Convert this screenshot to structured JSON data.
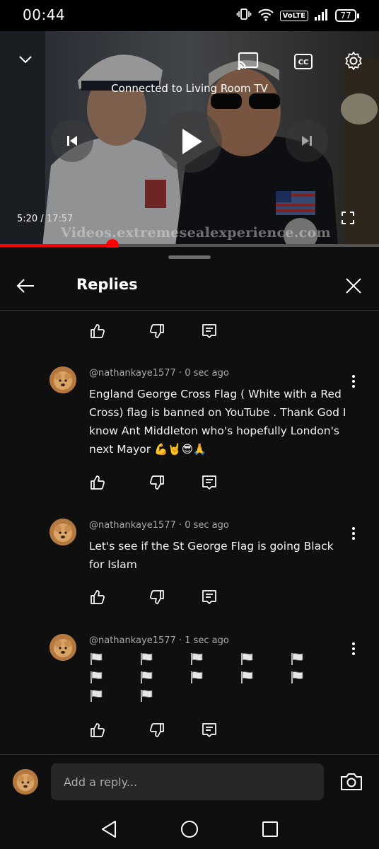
{
  "status_bar": {
    "time": "00:44",
    "volte": "VoLTE",
    "battery": "77",
    "icons": [
      "vibrate-icon",
      "wifi-icon",
      "signal-icon",
      "battery-icon"
    ]
  },
  "player": {
    "cast_status": "Connected to Living Room TV",
    "current_time": "5:20",
    "separator": " / ",
    "duration": "17:57",
    "watermark": "Videos.extremesealexperience.com",
    "progress_fraction": 0.296,
    "icons": [
      "collapse-chevron-icon",
      "cast-icon",
      "captions-icon",
      "settings-gear-icon",
      "previous-icon",
      "play-icon",
      "next-icon",
      "fullscreen-icon"
    ],
    "captions_label": "CC"
  },
  "sheet": {
    "title": "Replies",
    "icons": [
      "back-arrow-icon",
      "close-icon"
    ]
  },
  "comments": [
    {
      "author": "@nathankaye1577",
      "time": "0 sec ago",
      "text": "England George Cross Flag ( White with a Red Cross) flag is banned on YouTube . Thank God I know Ant Middleton who's hopefully London's next Mayor 💪🤘😎🙏"
    },
    {
      "author": "@nathankaye1577",
      "time": "0 sec ago",
      "text": "Let's see if the St George Flag is going Black for Islam"
    },
    {
      "author": "@nathankaye1577",
      "time": "1 sec ago",
      "text": "🏴🏴🏴🏴🏴🏴🏴🏴🏴🏴🏴🏴",
      "flag_count": 12
    }
  ],
  "comment_meta_separator": " · ",
  "actions": {
    "icons": [
      "like-icon",
      "dislike-icon",
      "reply-icon"
    ]
  },
  "reply_bar": {
    "placeholder": "Add a reply...",
    "icons": [
      "camera-icon"
    ]
  },
  "nav_bar": {
    "icons": [
      "back-triangle-icon",
      "home-circle-icon",
      "recents-square-icon"
    ]
  },
  "colors": {
    "progress": "#ff0000",
    "background": "#0f0f0f",
    "input_bg": "#272727",
    "meta_text": "#aaaaaa"
  }
}
